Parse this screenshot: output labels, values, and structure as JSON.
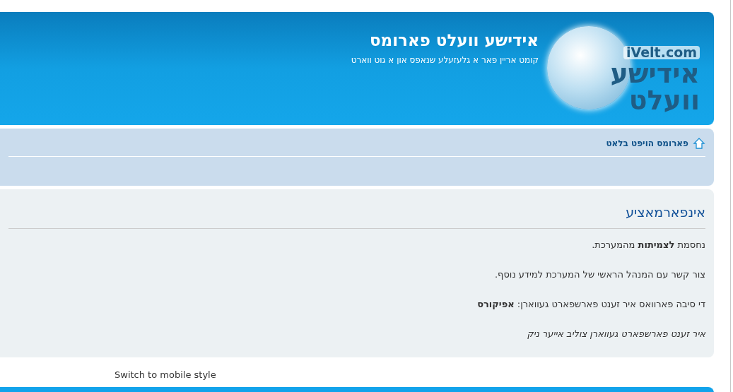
{
  "header": {
    "title": "אידישע וועלט פארומס",
    "tagline": "קומט אריין פאר א גלעזעלע שנאפס און א גוט ווארט",
    "logo": {
      "domain": "iVelt.com",
      "wordmark_line_1": "אידישע",
      "wordmark_line_2": "וועלט"
    }
  },
  "breadcrumb": {
    "label": "פארומס הויפט בלאט"
  },
  "info": {
    "heading": "אינפארמאציע",
    "paragraphs": [
      {
        "text": "נחסמת **לצמיתות** מהמערכת.",
        "italic": false
      },
      {
        "text": "צור קשר עם המנהל הראשי של המערכת למידע נוסף.",
        "italic": false
      },
      {
        "text": "די סיבה פארוואס איר זענט פארשפארט געווארן: **אפיקורס**",
        "italic": false
      },
      {
        "text": "איר זענט פארשפארט געווארן צוליב אייער ניק",
        "italic": true
      }
    ]
  },
  "footer": {
    "link": "Switch to mobile style"
  }
}
